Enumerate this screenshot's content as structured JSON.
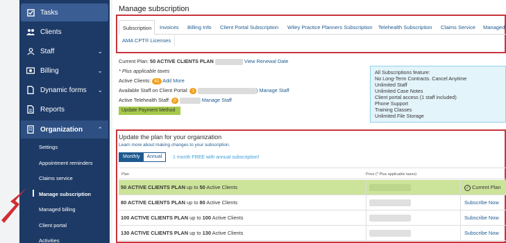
{
  "sidebar": {
    "items": [
      {
        "label": "Tasks",
        "icon": "checkbox-icon"
      },
      {
        "label": "Clients",
        "icon": "users-icon"
      },
      {
        "label": "Staff",
        "icon": "person-icon"
      },
      {
        "label": "Billing",
        "icon": "money-icon"
      },
      {
        "label": "Dynamic forms",
        "icon": "document-icon"
      },
      {
        "label": "Reports",
        "icon": "report-icon"
      },
      {
        "label": "Organization",
        "icon": "building-icon"
      }
    ],
    "sub_items": [
      "Settings",
      "Appointment reminders",
      "Claims service",
      "Manage subscription",
      "Managed billing",
      "Client portal",
      "Activities"
    ]
  },
  "page": {
    "title": "Manage subscription"
  },
  "tabs": [
    "Subscription",
    "Invoices",
    "Billing Info",
    "Client Portal Subscription",
    "Wiley Practice Planners Subscription",
    "Telehealth Subscription",
    "Claims Service",
    "Managed",
    "AMA CPT® Licenses"
  ],
  "current": {
    "plan_label": "Current Plan:",
    "plan_name": "50 ACTIVE CLIENTS PLAN",
    "renewal_link": "View Renewal Date",
    "taxes_note": "* Plus applicable taxes",
    "active_clients_label": "Active Clients:",
    "active_clients_count": "41",
    "add_more_link": "Add More",
    "portal_staff_label": "Available Staff on Client Portal:",
    "portal_staff_count": "1",
    "manage_staff_link": ") Manage Staff",
    "telehealth_label": "Active Telehealth Staff:",
    "telehealth_count": "0",
    "telehealth_manage_link": "Manage Staff",
    "update_payment_button": "Update Payment Method"
  },
  "features": {
    "heading": "All Subscriptions feature:",
    "items": [
      "No Long-Term Contracts. Cancel Anytime",
      "Unlimited Staff",
      "Unlimited Case Notes",
      "Client portal access (1 staff included)",
      "Phone Support",
      "Training Classes",
      "Unlimited File Storage"
    ]
  },
  "plans": {
    "title": "Update the plan for your organization",
    "learn_link": "Learn more about making changes to your subscription.",
    "toggle": {
      "monthly": "Monthly",
      "annual": "Annual"
    },
    "free_note": "1 month FREE with annual subscription!",
    "col_plan": "Plan",
    "col_price": "Price (* Plus applicable taxes)",
    "rows": [
      {
        "name": "50 ACTIVE CLIENTS PLAN",
        "upto": "up to",
        "count": "50",
        "suffix": "Active Clients",
        "action": "Current Plan"
      },
      {
        "name": "80 ACTIVE CLIENTS PLAN",
        "upto": "up to",
        "count": "80",
        "suffix": "Active Clients",
        "action": "Subscribe Now"
      },
      {
        "name": "100 ACTIVE CLIENTS PLAN",
        "upto": "up to",
        "count": "100",
        "suffix": "Active Clients",
        "action": "Subscribe Now"
      },
      {
        "name": "130 ACTIVE CLIENTS PLAN",
        "upto": "up to",
        "count": "130",
        "suffix": "Active Clients",
        "action": "Subscribe Now"
      }
    ]
  },
  "colors": {
    "nav": "#1d3a66",
    "accent": "#c9333a",
    "current_row": "#cce39a"
  }
}
